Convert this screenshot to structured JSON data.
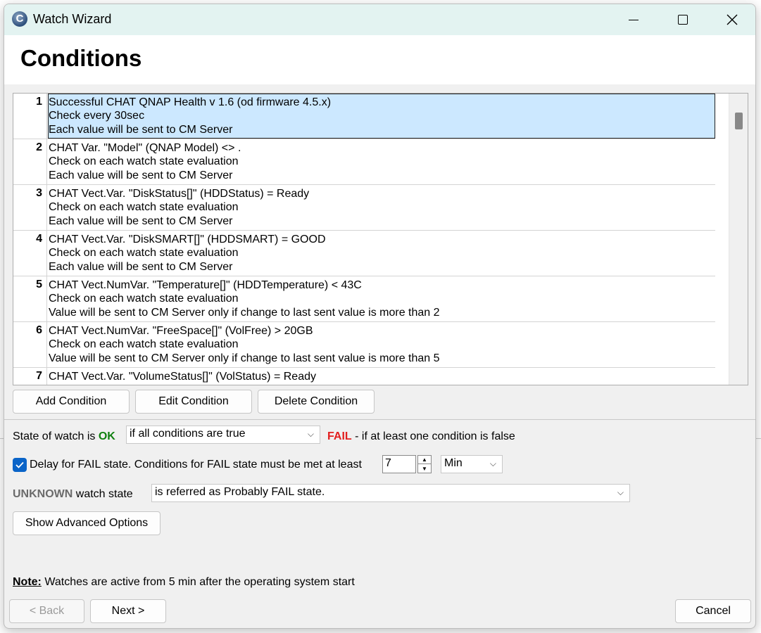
{
  "window": {
    "title": "Watch Wizard",
    "icon_letter": "C",
    "page_title": "Conditions"
  },
  "conditions": [
    {
      "num": "1",
      "lines": [
        "Successful CHAT QNAP Health v 1.6 (od firmware 4.5.x)",
        "Check every 30sec",
        "Each value will be sent to CM Server"
      ],
      "selected": true
    },
    {
      "num": "2",
      "lines": [
        "CHAT Var. \"Model\" (QNAP Model) <> .",
        "Check on each watch state evaluation",
        "Each value will be sent to CM Server"
      ]
    },
    {
      "num": "3",
      "lines": [
        "CHAT Vect.Var. \"DiskStatus[]\" (HDDStatus) = Ready",
        "Check on each watch state evaluation",
        "Each value will be sent to CM Server"
      ]
    },
    {
      "num": "4",
      "lines": [
        "CHAT Vect.Var. \"DiskSMART[]\" (HDDSMART) = GOOD",
        "Check on each watch state evaluation",
        "Each value will be sent to CM Server"
      ]
    },
    {
      "num": "5",
      "lines": [
        "CHAT Vect.NumVar. \"Temperature[]\" (HDDTemperature) < 43C",
        "Check on each watch state evaluation",
        "Value will be sent to CM Server only if change to last sent value is more than 2"
      ]
    },
    {
      "num": "6",
      "lines": [
        "CHAT Vect.NumVar. \"FreeSpace[]\" (VolFree) > 20GB",
        "Check on each watch state evaluation",
        "Value will be sent to CM Server only if change to last sent value is more than 5"
      ]
    },
    {
      "num": "7",
      "lines": [
        "CHAT Vect.Var. \"VolumeStatus[]\" (VolStatus) = Ready",
        "",
        ""
      ]
    }
  ],
  "condition_buttons": {
    "add": "Add Condition",
    "edit": "Edit Condition",
    "delete": "Delete Condition"
  },
  "state": {
    "prefix": "State of watch is ",
    "ok": "OK",
    "combo_value": "if all conditions are true",
    "fail": "FAIL",
    "fail_suffix": " - if at least one condition is false"
  },
  "delay": {
    "checked": true,
    "label": "Delay for FAIL state. Conditions for FAIL state must be met at least",
    "value": "7",
    "unit": "Min"
  },
  "unknown": {
    "bold": "UNKNOWN",
    "suffix": " watch state",
    "combo_value": "is referred as Probably FAIL state."
  },
  "advanced_button": "Show Advanced Options",
  "note": {
    "label": "Note:",
    "text": " Watches are active from 5 min after the operating system start"
  },
  "nav": {
    "back": "< Back",
    "next": "Next >",
    "cancel": "Cancel"
  },
  "colors": {
    "ok": "#108010",
    "fail": "#e21f1f",
    "selection": "#cce8ff",
    "titlebar": "#e3f3f1",
    "checkbox": "#0a64c8"
  }
}
